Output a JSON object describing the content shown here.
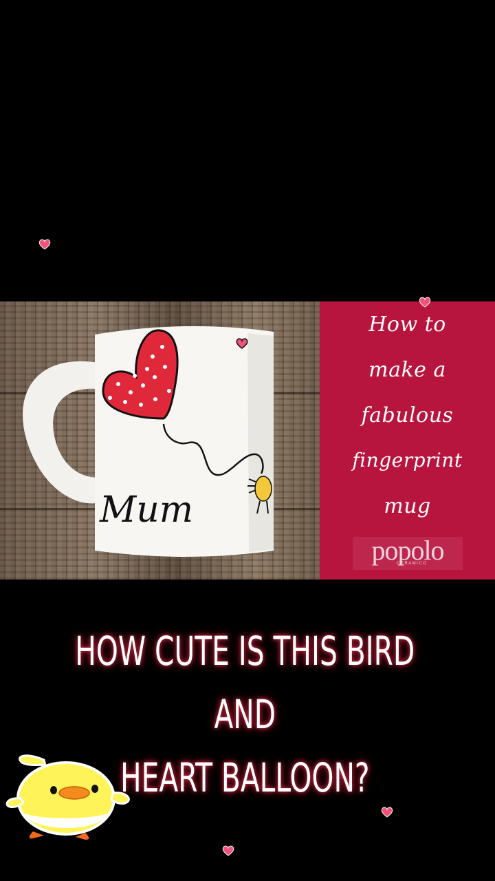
{
  "title_panel": {
    "lines": [
      "How to",
      "make a",
      "fabulous",
      "fingerprint",
      "mug"
    ],
    "brand": "popolo",
    "brand_sub": "CERAMICO",
    "background": "#b8153e"
  },
  "photo": {
    "mug_text": "Mum"
  },
  "caption": {
    "line1": "HOW CUTE IS THIS BIRD AND",
    "line2": "HEART BALLOON?"
  },
  "stickers": {
    "hearts": [
      "heart-icon",
      "heart-icon",
      "heart-icon",
      "heart-icon",
      "heart-icon"
    ],
    "chick": "chick-sticker"
  }
}
